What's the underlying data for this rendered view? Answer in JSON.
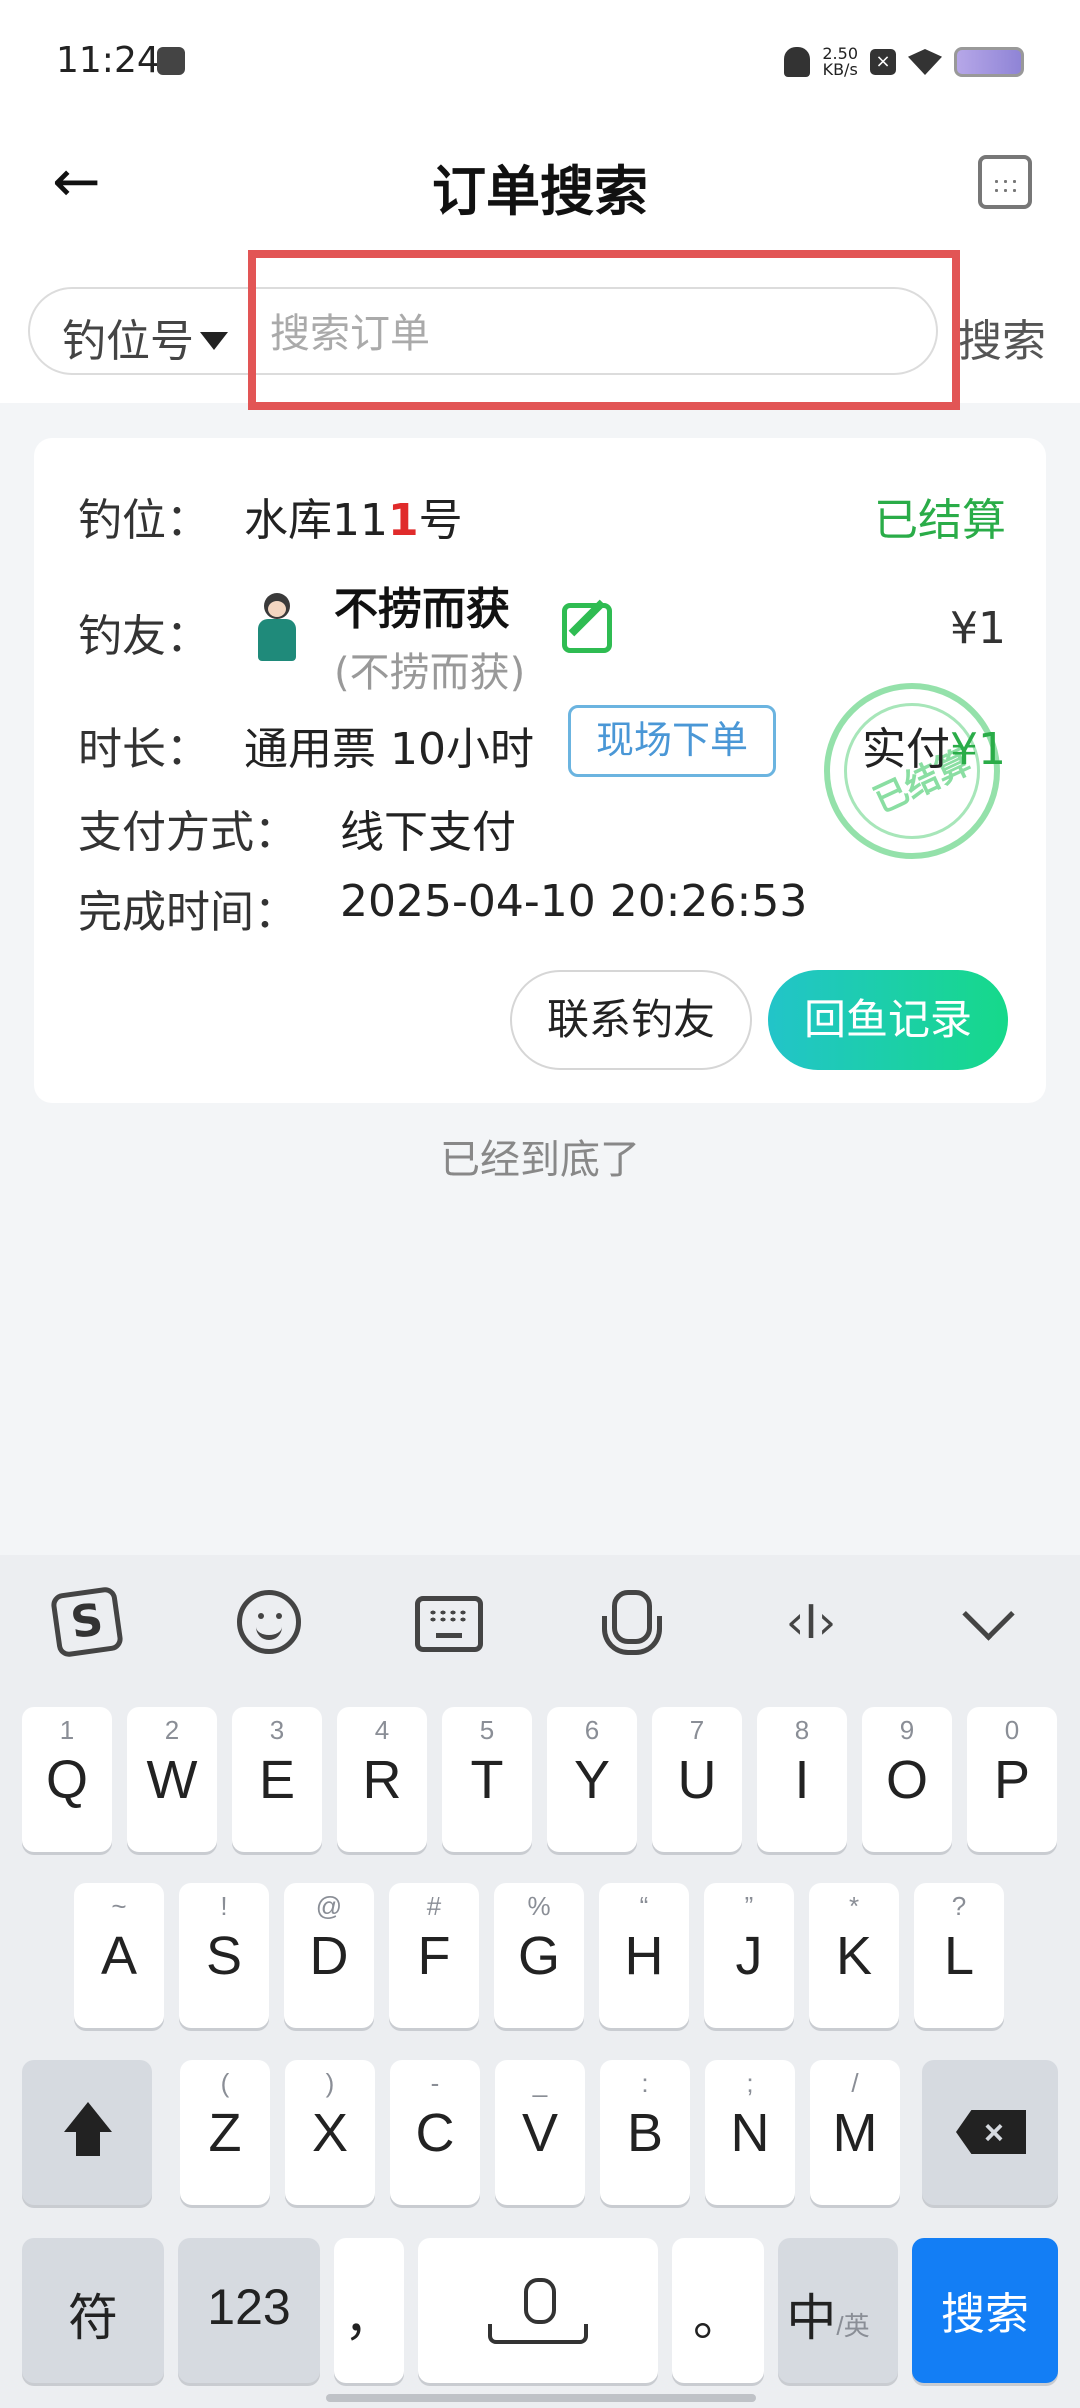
{
  "status_bar": {
    "time": "11:24",
    "speed": "2.50",
    "speed_unit": "KB/s"
  },
  "header": {
    "title": "订单搜索"
  },
  "search": {
    "selector": "钓位号",
    "placeholder": "搜索订单",
    "button": "搜索"
  },
  "order": {
    "spot_label": "钓位：",
    "spot_prefix": "水库11",
    "spot_highlight": "1",
    "spot_suffix": "号",
    "status": "已结算",
    "friend_label": "钓友：",
    "nickname": "不捞而获",
    "nickname_sub": "(不捞而获)",
    "price": "¥1",
    "duration_label": "时长：",
    "duration_value": "通用票 10小时",
    "tag": "现场下单",
    "paid_label": "实付",
    "paid_amount": "¥1",
    "stamp_text": "已结算",
    "payment_label": "支付方式：",
    "payment_value": "线下支付",
    "finish_label": "完成时间：",
    "finish_value": "2025-04-10 20:26:53",
    "contact_button": "联系钓友",
    "record_button": "回鱼记录"
  },
  "list_end": "已经到底了",
  "keyboard": {
    "row1": [
      {
        "k": "Q",
        "s": "1"
      },
      {
        "k": "W",
        "s": "2"
      },
      {
        "k": "E",
        "s": "3"
      },
      {
        "k": "R",
        "s": "4"
      },
      {
        "k": "T",
        "s": "5"
      },
      {
        "k": "Y",
        "s": "6"
      },
      {
        "k": "U",
        "s": "7"
      },
      {
        "k": "I",
        "s": "8"
      },
      {
        "k": "O",
        "s": "9"
      },
      {
        "k": "P",
        "s": "0"
      }
    ],
    "row2": [
      {
        "k": "A",
        "s": "~"
      },
      {
        "k": "S",
        "s": "!"
      },
      {
        "k": "D",
        "s": "@"
      },
      {
        "k": "F",
        "s": "#"
      },
      {
        "k": "G",
        "s": "%"
      },
      {
        "k": "H",
        "s": "“"
      },
      {
        "k": "J",
        "s": "”"
      },
      {
        "k": "K",
        "s": "*"
      },
      {
        "k": "L",
        "s": "?"
      }
    ],
    "row3": [
      {
        "k": "Z",
        "s": "("
      },
      {
        "k": "X",
        "s": ")"
      },
      {
        "k": "C",
        "s": "-"
      },
      {
        "k": "V",
        "s": "_"
      },
      {
        "k": "B",
        "s": ":"
      },
      {
        "k": "N",
        "s": ";"
      },
      {
        "k": "M",
        "s": "/"
      }
    ],
    "symbol_key": "符",
    "number_key": "123",
    "comma_key": "，",
    "period_key": "。",
    "lang_key": "中",
    "lang_sub": "/英",
    "search_key": "搜索",
    "cursor_tool": "‹I›"
  }
}
